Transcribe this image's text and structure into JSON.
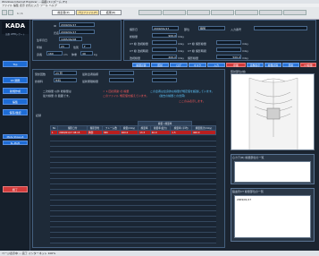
{
  "window": {
    "title": "Windows Internet Explorer ... 画面 (1) [ズーム (F)]"
  },
  "menubar": {
    "text": "ファイル  編集  表示  お気に入り  ツール  ヘルプ"
  },
  "toolbar": {
    "page": "1 / 1",
    "buttons": [
      "前患者(P)",
      "プロファイル(F)",
      "結果(R)"
    ]
  },
  "logo": {
    "text": "KADA",
    "sub": "読影 WEBレポート"
  },
  "sidebar": {
    "buttons": [
      "Top",
      "16 期限",
      "新規作成",
      "編集",
      "保存/確認"
    ],
    "lower": [
      "Mode Show+R",
      "SL-Mx/R"
    ],
    "close": "終了"
  },
  "patient": {
    "id_label": "ID",
    "id_value": "2009/01/17",
    "name_label": "氏名",
    "name_value": "2009/01/17",
    "birth_label": "生年月日",
    "birth_value": "1985/09/08",
    "age_label": "年齢",
    "age_value": "23",
    "sex_label": "性別",
    "sex_value": "F",
    "height_label": "身長",
    "height_value": "160",
    "height_unit": "cm",
    "weight_label": "体重",
    "weight_value": "49",
    "weight_unit": "kg"
  },
  "exam": {
    "rows": [
      {
        "l1": "撮影日",
        "v1": "2009/01/17",
        "l2": "部位",
        "v2": "胸部",
        "l3": "入力番号",
        "v3": ""
      },
      {
        "l1": "総線量",
        "v1": "900.0",
        "u1": "mGy",
        "l2": "",
        "v2": "",
        "l3": "",
        "v3": ""
      },
      {
        "l1": "CT 線 透視線量",
        "v1": "",
        "u1": "mGy",
        "l2": "CT 線 撮影線量",
        "v2": "",
        "u2": "mGy",
        "l3": "",
        "v3": ""
      },
      {
        "l1": "CT 線 透視時間",
        "v1": "",
        "u1": "mGy",
        "l2": "CT 線 撮影時間",
        "v2": "",
        "u2": "mGy",
        "l3": "",
        "v3": ""
      },
      {
        "l1": "透視線量",
        "v1": "400.0",
        "u1": "mGy",
        "l2": "撮影線量",
        "v2": "500.0",
        "u2": "mGy",
        "l3": "",
        "v3": ""
      }
    ],
    "tabs": [
      "線量計算",
      "照射",
      "ログ",
      "マスク",
      "入力",
      "印刷",
      "戻る"
    ]
  },
  "summary": {
    "rows": [
      {
        "l": "受診回数",
        "v": "23 回",
        "l2": "最新患者指標"
      },
      {
        "l": "診療科",
        "v": "外科",
        "l2": "最新累積線量"
      }
    ],
    "warn1": "☆ 1 回の照射 の 線量",
    "warn2": "このファイル 規定値を超えています。",
    "info1": "この患者は全身的な線量が規定値を超過しています。",
    "info2": "(過去の線量との合算)",
    "warn3": "ここのみ表示します。",
    "note1": "二次線量 以外 総線量は",
    "note2": "最大線量 の 範囲です。",
    "col_header": "線量 / 線量率"
  },
  "table": {
    "title": "記録",
    "group": "線量 / 線量率",
    "headers": [
      "No",
      "撮影日付",
      "撮影部位",
      "フレーム数",
      "線量(mGy)",
      "線量率",
      "線量率(最大)",
      "線量率 (平均)",
      "線量累計(mGy)"
    ],
    "rows": [
      [
        "1",
        "2009/01/17 08:15",
        "胸部",
        "380",
        "400.0",
        "13.3",
        "40.0",
        "1.5",
        "400.0"
      ]
    ]
  },
  "right": {
    "buttons": [
      "画像表示",
      "線量計算",
      "照射",
      "CT線量"
    ],
    "figure_label": "照射部位(前)",
    "list1_title": "心カテ(B) 線量部位の一覧",
    "list2_title": "脳血管CT 線量部位の一覧",
    "list2_item": "2009/01/17"
  },
  "statusbar": {
    "text": "ページ表示中 ... 完了  インターネット  100%"
  }
}
